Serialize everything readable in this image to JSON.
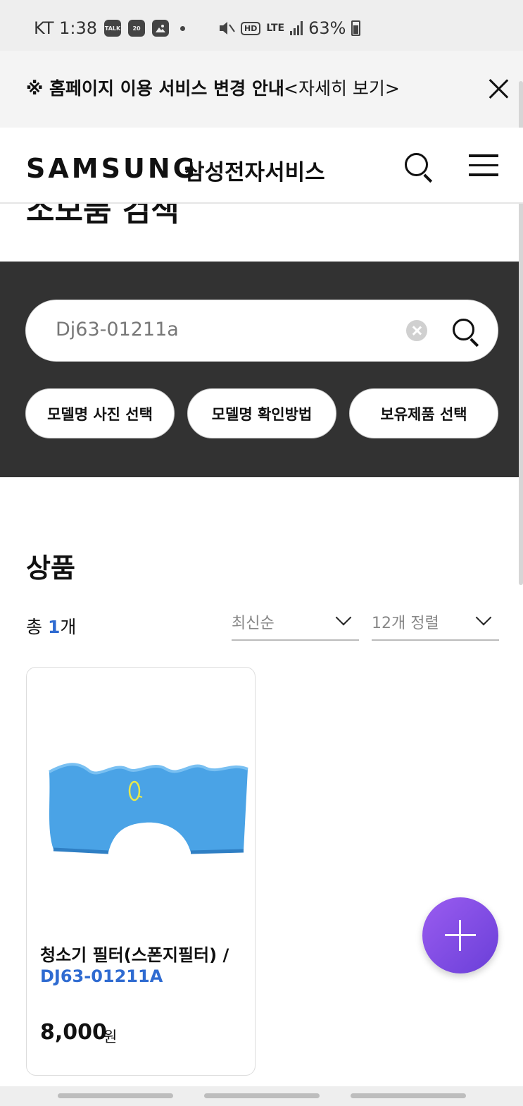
{
  "status_bar": {
    "carrier_time": "KT 1:38",
    "network": "LTE",
    "battery": "63%",
    "hd_label": "HD",
    "app_icons": [
      "talk-icon",
      "blog-icon",
      "gallery-icon"
    ]
  },
  "notice": {
    "text": "※ 홈페이지 이용 서비스 변경 안내",
    "link": "<자세히 보기>"
  },
  "header": {
    "logo": "SAMSUNG",
    "brand_sub": "삼성전자서비스"
  },
  "partial_title": "소모품 검색",
  "search": {
    "value": "Dj63-01211a"
  },
  "chips": [
    {
      "label": "모델명 사진 선택"
    },
    {
      "label": "모델명 확인방법"
    },
    {
      "label": "보유제품 선택"
    }
  ],
  "products_section": {
    "title": "상품",
    "total_prefix": "총 ",
    "total_count": "1",
    "total_suffix": "개",
    "sort_select": "최신순",
    "per_page_select": "12개 정렬"
  },
  "product": {
    "name": "청소기 필터(스폰지필터) /",
    "code": "DJ63-01211A",
    "price": "8,000",
    "currency": "원"
  },
  "colors": {
    "accent_blue": "#2f6bd1",
    "panel_dark": "#323232",
    "fab_purple": "#7b4be0",
    "sponge_blue": "#4aa3e6"
  }
}
